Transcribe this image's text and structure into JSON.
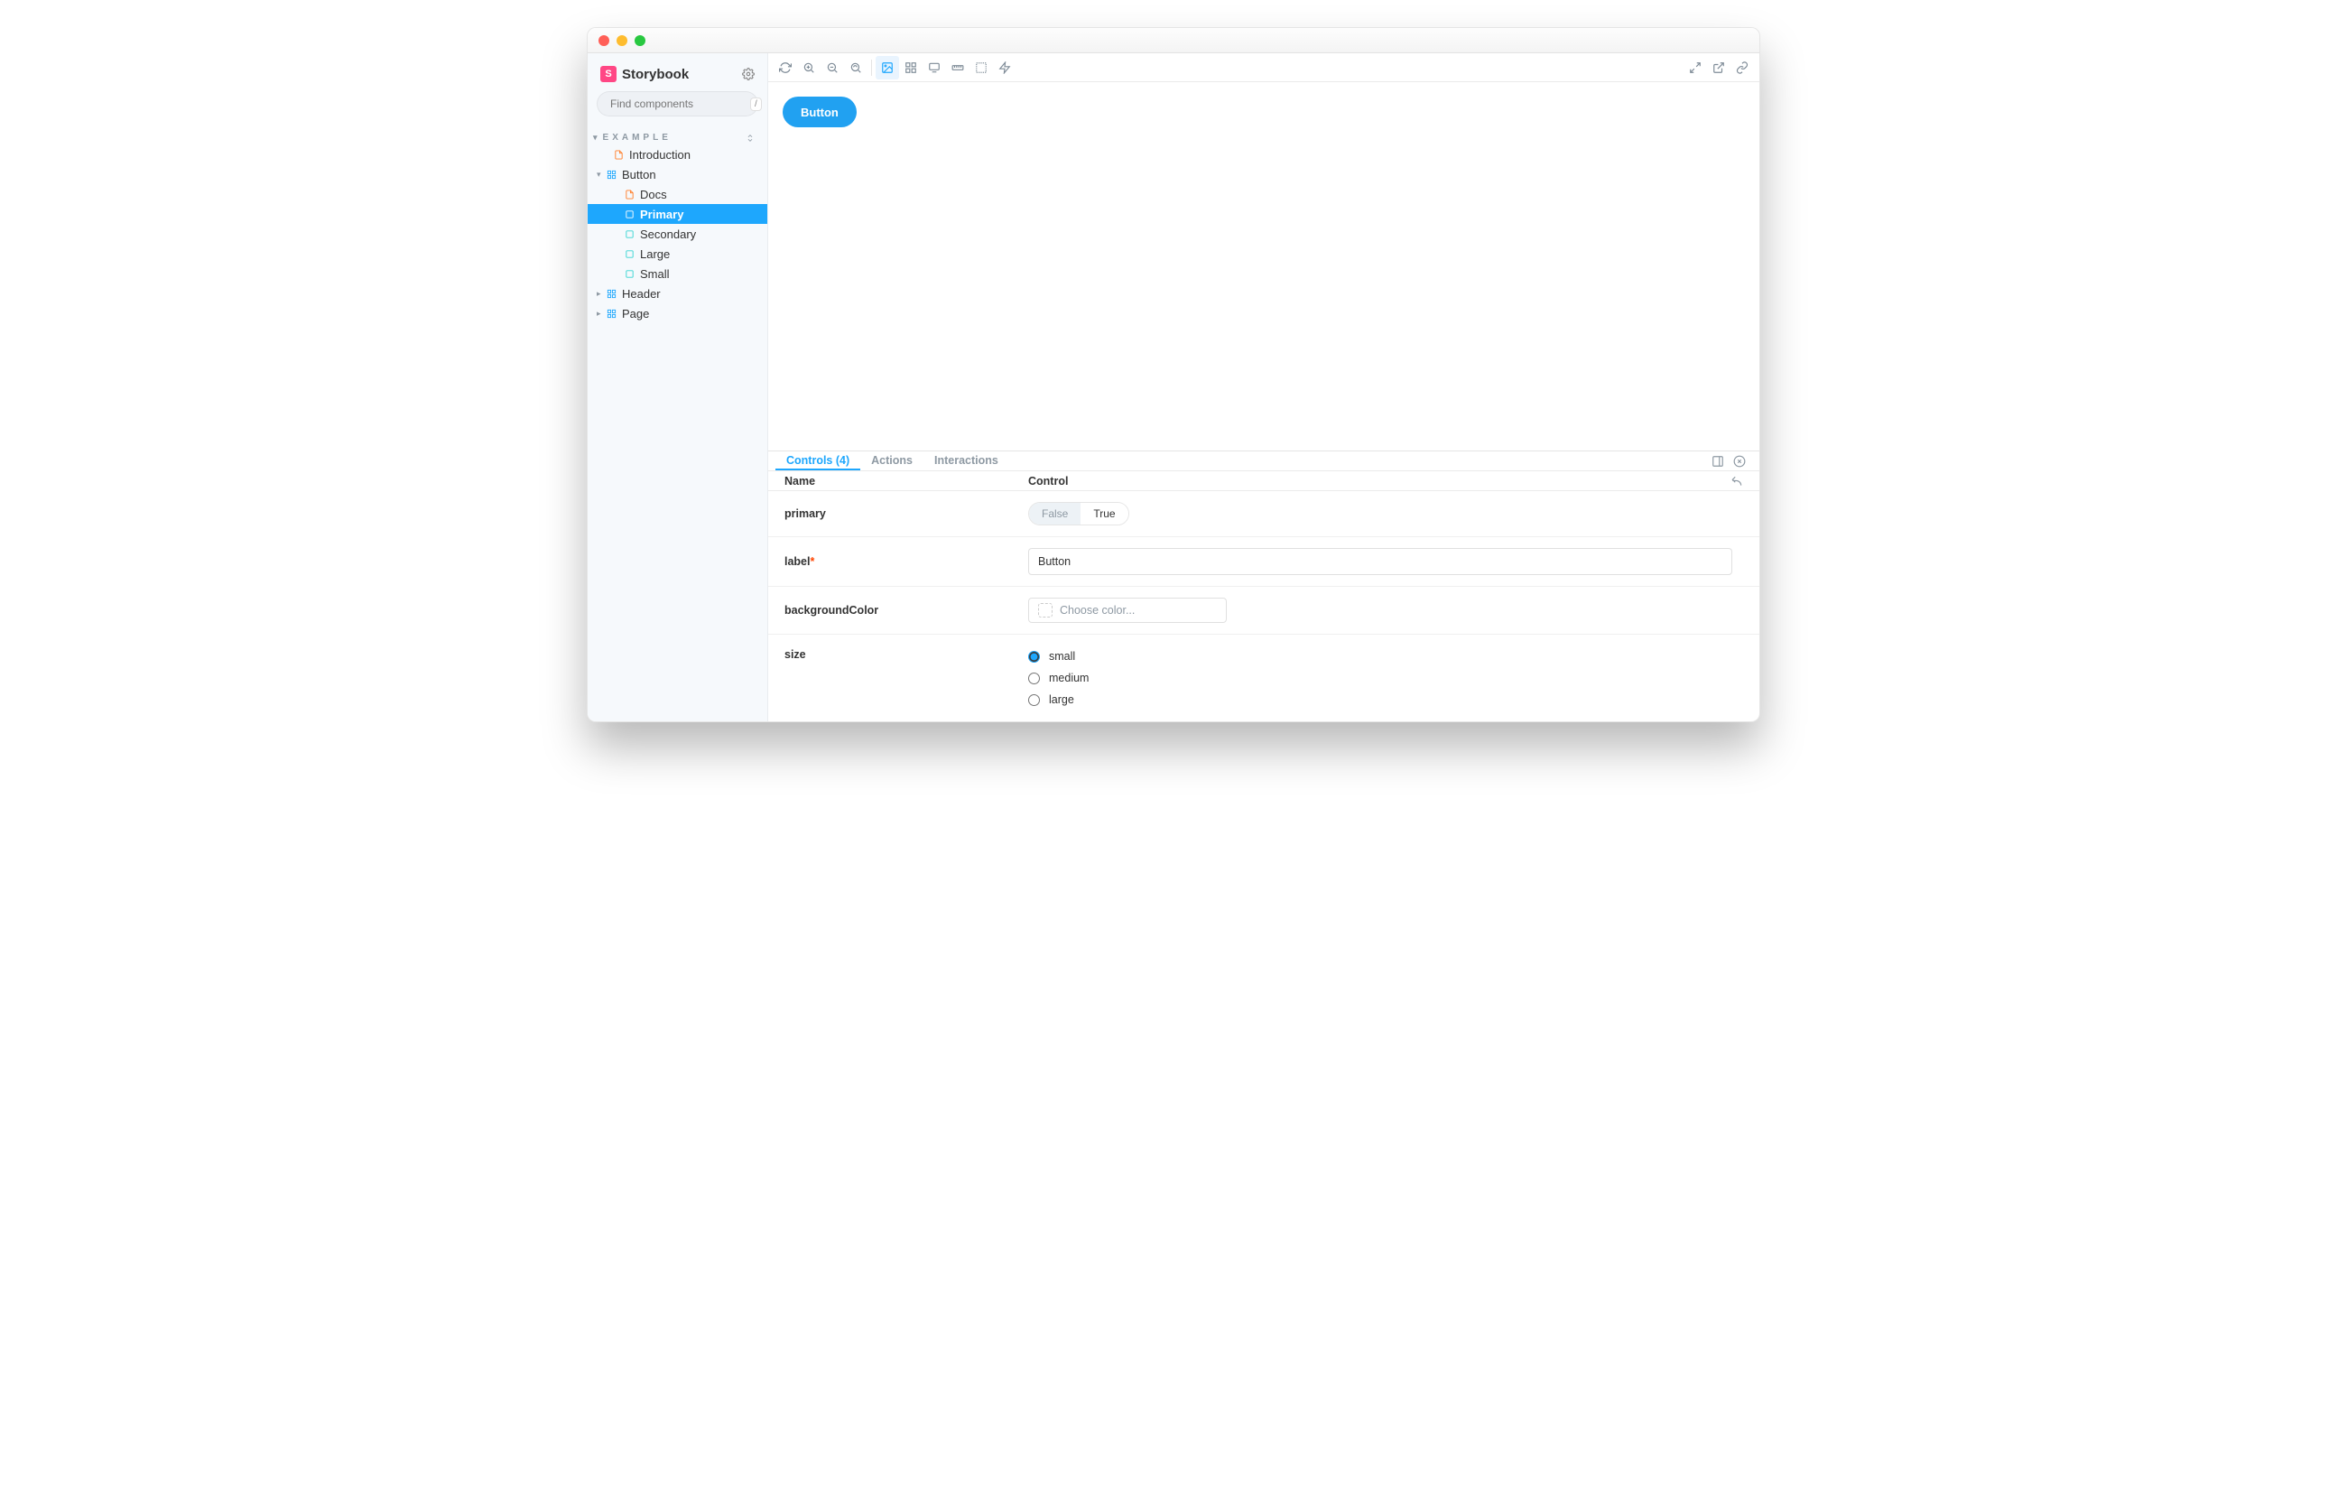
{
  "app_name": "Storybook",
  "search": {
    "placeholder": "Find components",
    "shortcut": "/"
  },
  "sidebar": {
    "section": "EXAMPLE",
    "items": [
      {
        "kind": "docs",
        "depth": 1,
        "label": "Introduction"
      },
      {
        "kind": "component",
        "depth": 0,
        "label": "Button",
        "arrow": "▾"
      },
      {
        "kind": "docs",
        "depth": 2,
        "label": "Docs"
      },
      {
        "kind": "story",
        "depth": 2,
        "label": "Primary",
        "selected": true
      },
      {
        "kind": "story",
        "depth": 2,
        "label": "Secondary"
      },
      {
        "kind": "story",
        "depth": 2,
        "label": "Large"
      },
      {
        "kind": "story",
        "depth": 2,
        "label": "Small"
      },
      {
        "kind": "component",
        "depth": 0,
        "label": "Header",
        "arrow": "▸"
      },
      {
        "kind": "component",
        "depth": 0,
        "label": "Page",
        "arrow": "▸"
      }
    ]
  },
  "canvas": {
    "button_label": "Button"
  },
  "addons": {
    "tabs": [
      {
        "label": "Controls (4)",
        "active": true
      },
      {
        "label": "Actions"
      },
      {
        "label": "Interactions"
      }
    ],
    "columns": {
      "name": "Name",
      "control": "Control"
    },
    "controls": {
      "primary": {
        "name": "primary",
        "false": "False",
        "true": "True",
        "value": true
      },
      "label": {
        "name": "label",
        "required": true,
        "value": "Button"
      },
      "backgroundColor": {
        "name": "backgroundColor",
        "placeholder": "Choose color..."
      },
      "size": {
        "name": "size",
        "options": [
          "small",
          "medium",
          "large"
        ],
        "value": "small"
      }
    }
  }
}
